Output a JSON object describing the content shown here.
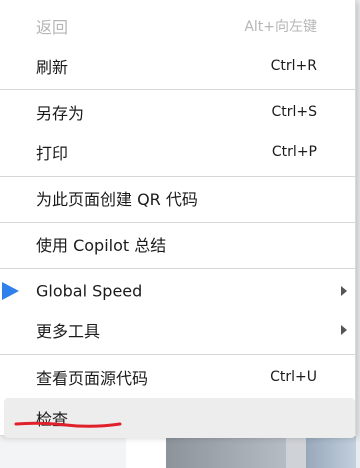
{
  "menu": {
    "items": [
      {
        "label": "返回",
        "shortcut": "Alt+向左键"
      },
      {
        "label": "刷新",
        "shortcut": "Ctrl+R"
      },
      {
        "label": "另存为",
        "shortcut": "Ctrl+S"
      },
      {
        "label": "打印",
        "shortcut": "Ctrl+P"
      },
      {
        "label": "为此页面创建 QR 代码"
      },
      {
        "label": "使用 Copilot 总结"
      },
      {
        "label": "Global Speed",
        "icon": "global-speed-extension-icon"
      },
      {
        "label": "更多工具"
      },
      {
        "label": "查看页面源代码",
        "shortcut": "Ctrl+U"
      },
      {
        "label": "检查"
      }
    ]
  },
  "colors": {
    "extension_icon": "#2f80ed",
    "hover_background": "#ededed",
    "annotation_stroke": "#e0202a"
  }
}
